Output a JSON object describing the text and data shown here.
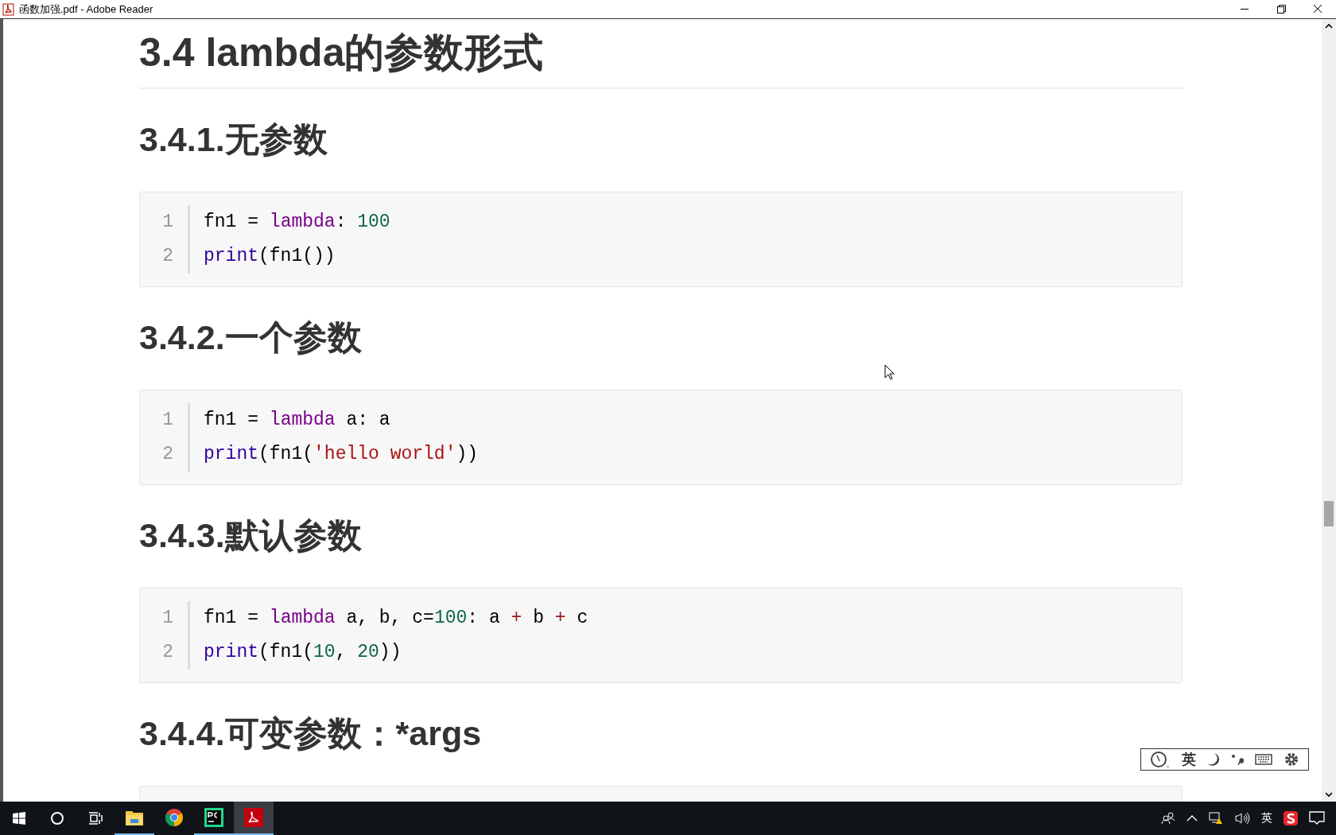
{
  "window": {
    "title": "函数加强.pdf - Adobe Reader"
  },
  "document": {
    "heading": "3.4 lambda的参数形式",
    "sections": [
      {
        "heading": "3.4.1.无参数",
        "code": [
          {
            "number": "1",
            "tokens": [
              {
                "kind": "plain",
                "text": "fn1 = "
              },
              {
                "kind": "keyword",
                "text": "lambda"
              },
              {
                "kind": "plain",
                "text": ": "
              },
              {
                "kind": "number",
                "text": "100"
              }
            ]
          },
          {
            "number": "2",
            "tokens": [
              {
                "kind": "builtin",
                "text": "print"
              },
              {
                "kind": "plain",
                "text": "(fn1())"
              }
            ]
          }
        ]
      },
      {
        "heading": "3.4.2.一个参数",
        "code": [
          {
            "number": "1",
            "tokens": [
              {
                "kind": "plain",
                "text": "fn1 = "
              },
              {
                "kind": "keyword",
                "text": "lambda"
              },
              {
                "kind": "plain",
                "text": " a: a"
              }
            ]
          },
          {
            "number": "2",
            "tokens": [
              {
                "kind": "builtin",
                "text": "print"
              },
              {
                "kind": "plain",
                "text": "(fn1("
              },
              {
                "kind": "string",
                "text": "'hello world'"
              },
              {
                "kind": "plain",
                "text": "))"
              }
            ]
          }
        ]
      },
      {
        "heading": "3.4.3.默认参数",
        "code": [
          {
            "number": "1",
            "tokens": [
              {
                "kind": "plain",
                "text": "fn1 = "
              },
              {
                "kind": "keyword",
                "text": "lambda"
              },
              {
                "kind": "plain",
                "text": " a, b, c="
              },
              {
                "kind": "number",
                "text": "100"
              },
              {
                "kind": "plain",
                "text": ": a "
              },
              {
                "kind": "operator",
                "text": "+"
              },
              {
                "kind": "plain",
                "text": " b "
              },
              {
                "kind": "operator",
                "text": "+"
              },
              {
                "kind": "plain",
                "text": " c"
              }
            ]
          },
          {
            "number": "2",
            "tokens": [
              {
                "kind": "builtin",
                "text": "print"
              },
              {
                "kind": "plain",
                "text": "(fn1("
              },
              {
                "kind": "number",
                "text": "10"
              },
              {
                "kind": "plain",
                "text": ", "
              },
              {
                "kind": "number",
                "text": "20"
              },
              {
                "kind": "plain",
                "text": "))"
              }
            ]
          }
        ]
      },
      {
        "heading": "3.4.4.可变参数：*args"
      }
    ]
  },
  "ime_toolbar": {
    "mode": "英"
  },
  "taskbar": {
    "apps": [
      {
        "kind": "explorer",
        "running": true,
        "selected": false
      },
      {
        "kind": "chrome",
        "running": false,
        "selected": false
      },
      {
        "kind": "pycharm",
        "running": true,
        "selected": false
      },
      {
        "kind": "acrobat",
        "running": true,
        "selected": true
      }
    ],
    "input_mode": "英"
  }
}
